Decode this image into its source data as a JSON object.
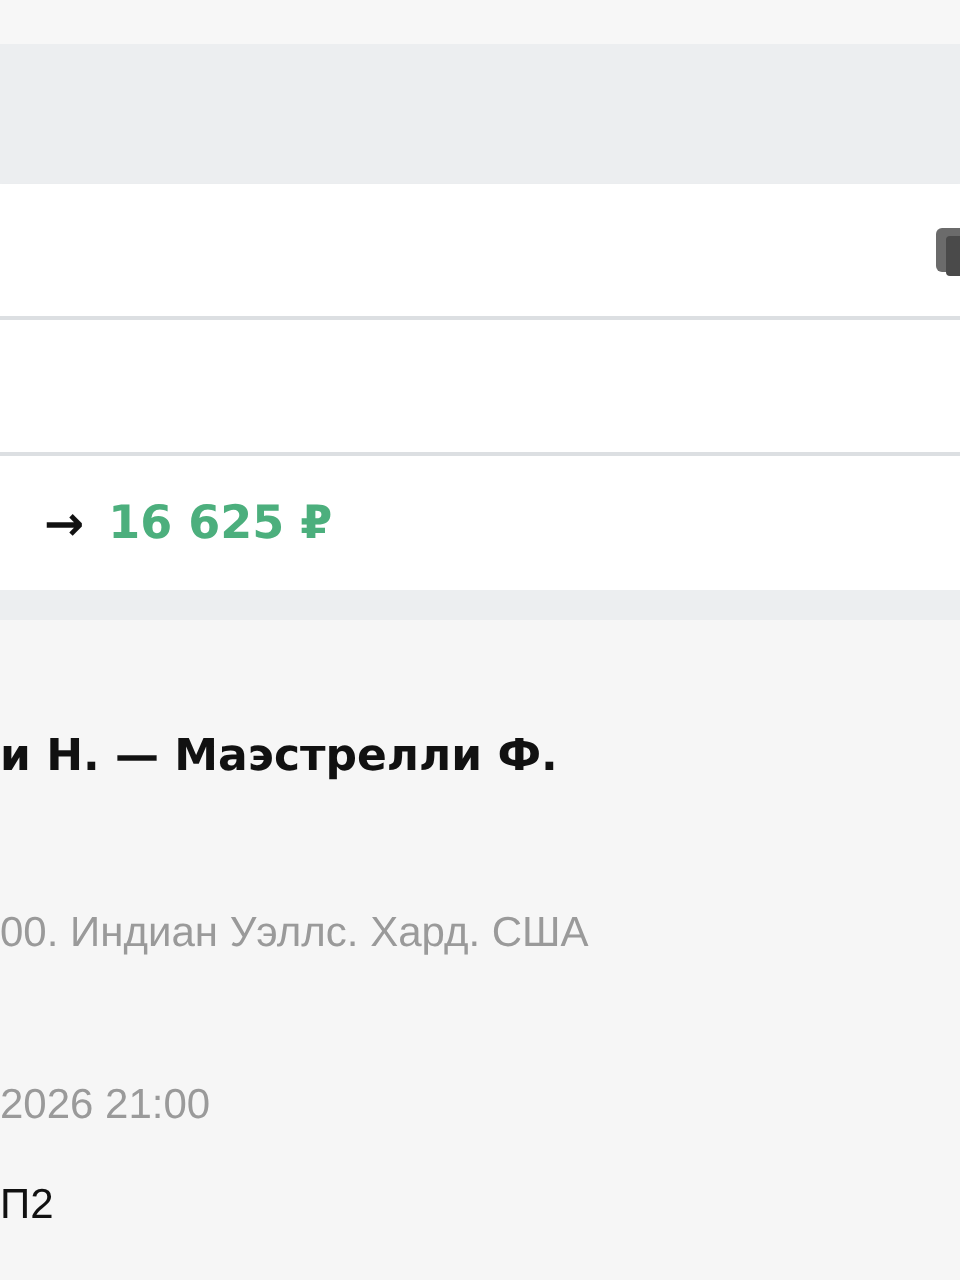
{
  "bet_card": {
    "old_to_new_arrow": "→",
    "new_amount": "16 625 ₽"
  },
  "event": {
    "title": "и Н. — Маэстрелли Ф.",
    "tournament": "00. Индиан Уэллс. Хард. США",
    "date": "2026 21:00",
    "outcome": "П2"
  }
}
